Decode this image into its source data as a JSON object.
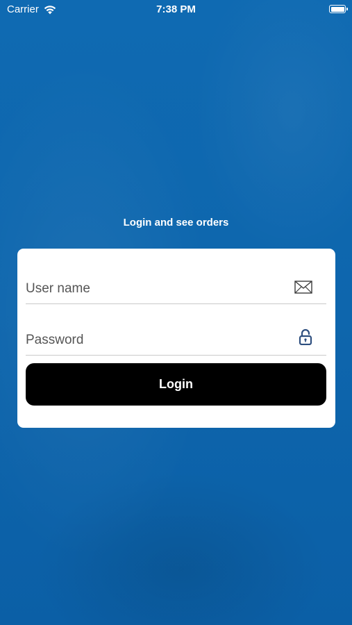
{
  "status_bar": {
    "carrier": "Carrier",
    "time": "7:38 PM",
    "icons": [
      "wifi-icon",
      "battery-icon"
    ]
  },
  "login": {
    "subtitle": "Login and see orders",
    "username_placeholder": "User name",
    "username_value": "",
    "username_icon": "envelope-icon",
    "password_placeholder": "Password",
    "password_value": "",
    "password_icon": "lock-icon",
    "button_label": "Login"
  },
  "colors": {
    "background": "#0f67b0",
    "card": "#ffffff",
    "button": "#000000",
    "icon": "#2e4f7f"
  }
}
